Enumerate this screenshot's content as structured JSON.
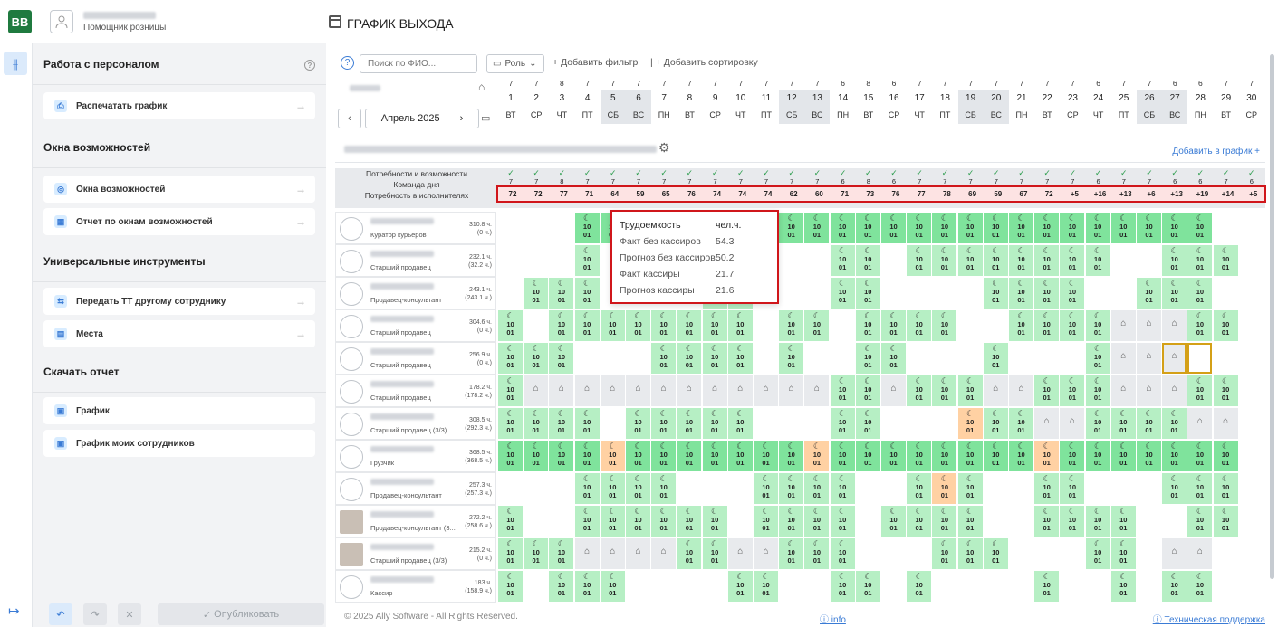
{
  "header": {
    "logo": "BB",
    "user_role": "Помощник розницы",
    "page_title": "ГРАФИК ВЫХОДА"
  },
  "sidebar": {
    "sections": [
      {
        "title": "Работа с персоналом",
        "items": [
          {
            "label": "Распечатать график",
            "icon": "printer-icon"
          }
        ]
      },
      {
        "title": "Окна возможностей",
        "items": [
          {
            "label": "Окна возможностей",
            "icon": "target-icon"
          },
          {
            "label": "Отчет по окнам возможностей",
            "icon": "report-icon"
          }
        ]
      },
      {
        "title": "Универсальные инструменты",
        "items": [
          {
            "label": "Передать ТТ другому сотруднику",
            "icon": "transfer-icon"
          },
          {
            "label": "Места",
            "icon": "places-icon"
          }
        ]
      },
      {
        "title": "Скачать отчет",
        "items": [
          {
            "label": "График",
            "icon": "file-icon"
          },
          {
            "label": "График моих сотрудников",
            "icon": "file-icon"
          }
        ]
      }
    ],
    "publish_label": "Опубликовать"
  },
  "toolbar": {
    "search_placeholder": "Поиск по ФИО...",
    "role_label": "Роль",
    "add_filter": "Добавить фильтр",
    "add_sort": "Добавить сортировку",
    "month": "Апрель 2025",
    "add_to_graph": "Добавить в график"
  },
  "calendar": {
    "counts": [
      "7",
      "7",
      "8",
      "7",
      "7",
      "7",
      "7",
      "7",
      "7",
      "7",
      "7",
      "7",
      "7",
      "6",
      "8",
      "6",
      "7",
      "7",
      "7",
      "7",
      "7",
      "7",
      "7",
      "6",
      "7",
      "7",
      "6",
      "6",
      "7",
      "7",
      "6"
    ],
    "days": [
      "1",
      "2",
      "3",
      "4",
      "5",
      "6",
      "7",
      "8",
      "9",
      "10",
      "11",
      "12",
      "13",
      "14",
      "15",
      "16",
      "17",
      "18",
      "19",
      "20",
      "21",
      "22",
      "23",
      "24",
      "25",
      "26",
      "27",
      "28",
      "29",
      "30"
    ],
    "weekdays": [
      "ВТ",
      "СР",
      "ЧТ",
      "ПТ",
      "СБ",
      "ВС",
      "ПН",
      "ВТ",
      "СР",
      "ЧТ",
      "ПТ",
      "СБ",
      "ВС",
      "ПН",
      "ВТ",
      "СР",
      "ЧТ",
      "ПТ",
      "СБ",
      "ВС",
      "ПН",
      "ВТ",
      "СР",
      "ЧТ",
      "ПТ",
      "СБ",
      "ВС",
      "ПН",
      "ВТ",
      "СР"
    ]
  },
  "needs": {
    "labels": [
      "Потребности и возможности",
      "Команда дня",
      "Потребность в исполнителях"
    ],
    "team": [
      "7",
      "7",
      "8",
      "7",
      "7",
      "7",
      "7",
      "7",
      "7",
      "7",
      "7",
      "7",
      "7",
      "6",
      "8",
      "6",
      "7",
      "7",
      "7",
      "7",
      "7",
      "7",
      "7",
      "6",
      "7",
      "7",
      "6",
      "6",
      "7",
      "6"
    ],
    "values": [
      "72",
      "72",
      "77",
      "71",
      "64",
      "59",
      "65",
      "76",
      "74",
      "74",
      "74",
      "62",
      "60",
      "71",
      "73",
      "76",
      "77",
      "78",
      "69",
      "59",
      "67",
      "72",
      "+5",
      "+16",
      "+13",
      "+6",
      "+13",
      "+19",
      "+14",
      "+5"
    ]
  },
  "employees": [
    {
      "position": "Куратор курьеров",
      "hours": "310.8 ч.",
      "hours2": "(0 ч.)"
    },
    {
      "position": "Старший продавец",
      "hours": "232.1 ч.",
      "hours2": "(32.2 ч.)"
    },
    {
      "position": "Продавец-консультант",
      "hours": "243.1 ч.",
      "hours2": "(243.1 ч.)"
    },
    {
      "position": "Старший продавец",
      "hours": "304.6 ч.",
      "hours2": "(0 ч.)"
    },
    {
      "position": "Старший продавец",
      "hours": "256.9 ч.",
      "hours2": "(0 ч.)"
    },
    {
      "position": "Старший продавец",
      "hours": "178.2 ч.",
      "hours2": "(178.2 ч.)"
    },
    {
      "position": "Старший продавец (3/3)",
      "hours": "308.5 ч.",
      "hours2": "(292.3 ч.)"
    },
    {
      "position": "Грузчик",
      "hours": "368.5 ч.",
      "hours2": "(368.5 ч.)"
    },
    {
      "position": "Продавец-консультант",
      "hours": "257.3 ч.",
      "hours2": "(257.3 ч.)"
    },
    {
      "position": "Продавец-консультант (3...",
      "hours": "272.2 ч.",
      "hours2": "(258.6 ч.)"
    },
    {
      "position": "Старший продавец (3/3)",
      "hours": "215.2 ч.",
      "hours2": "(0 ч.)"
    },
    {
      "position": "Кассир",
      "hours": "183 ч.",
      "hours2": "(158.9 ч.)"
    }
  ],
  "tooltip": {
    "rows": [
      {
        "label": "Трудоемкость",
        "value": "чел.ч."
      },
      {
        "label": "Факт без кассиров",
        "value": "54.3"
      },
      {
        "label": "Прогноз без кассиров",
        "value": "50.2"
      },
      {
        "label": "Факт кассиры",
        "value": "21.7"
      },
      {
        "label": "Прогноз кассиры",
        "value": "21.6"
      }
    ]
  },
  "footer": {
    "copyright": "© 2025 Ally Software - All Rights Reserved.",
    "info": "info",
    "support": "Техническая поддержка"
  },
  "colors": {
    "accent": "#3a7bd5",
    "shift_green": "#b6efc4",
    "shift_dark_green": "#7fe39c",
    "shift_orange": "#ffd1a3",
    "alert_red": "#d0161b"
  }
}
